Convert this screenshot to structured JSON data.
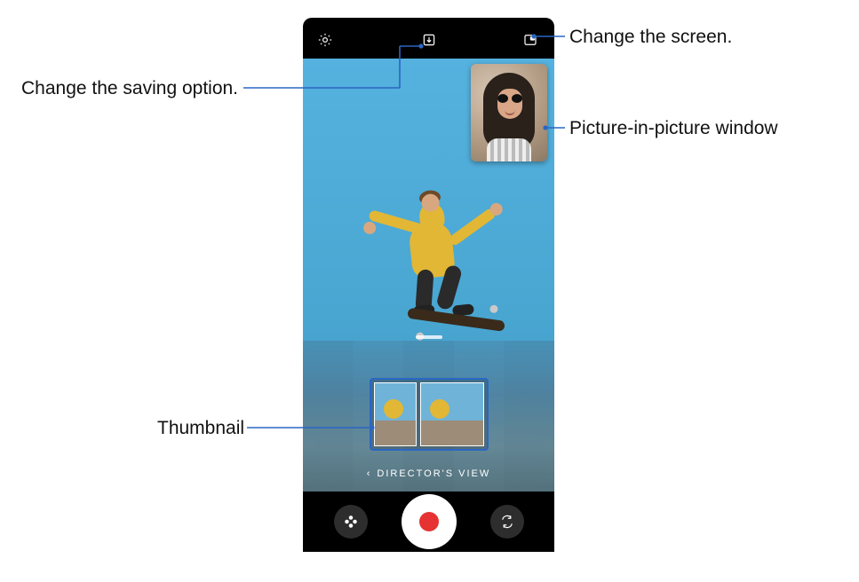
{
  "labels": {
    "saving": "Change the saving option.",
    "screen": "Change the screen.",
    "pip": "Picture-in-picture window",
    "thumb": "Thumbnail"
  },
  "topbar": {
    "icons": {
      "settings": "gear-icon",
      "saving": "download-in-box-icon",
      "pip_toggle": "pip-layout-icon"
    }
  },
  "mode": {
    "chevron": "‹",
    "name": "DIRECTOR'S VIEW"
  },
  "bottombar": {
    "left": "sparkle-icon",
    "record": "record-button",
    "right": "switch-camera-icon"
  },
  "colors": {
    "callout": "#2a66c4",
    "record": "#e63232"
  }
}
